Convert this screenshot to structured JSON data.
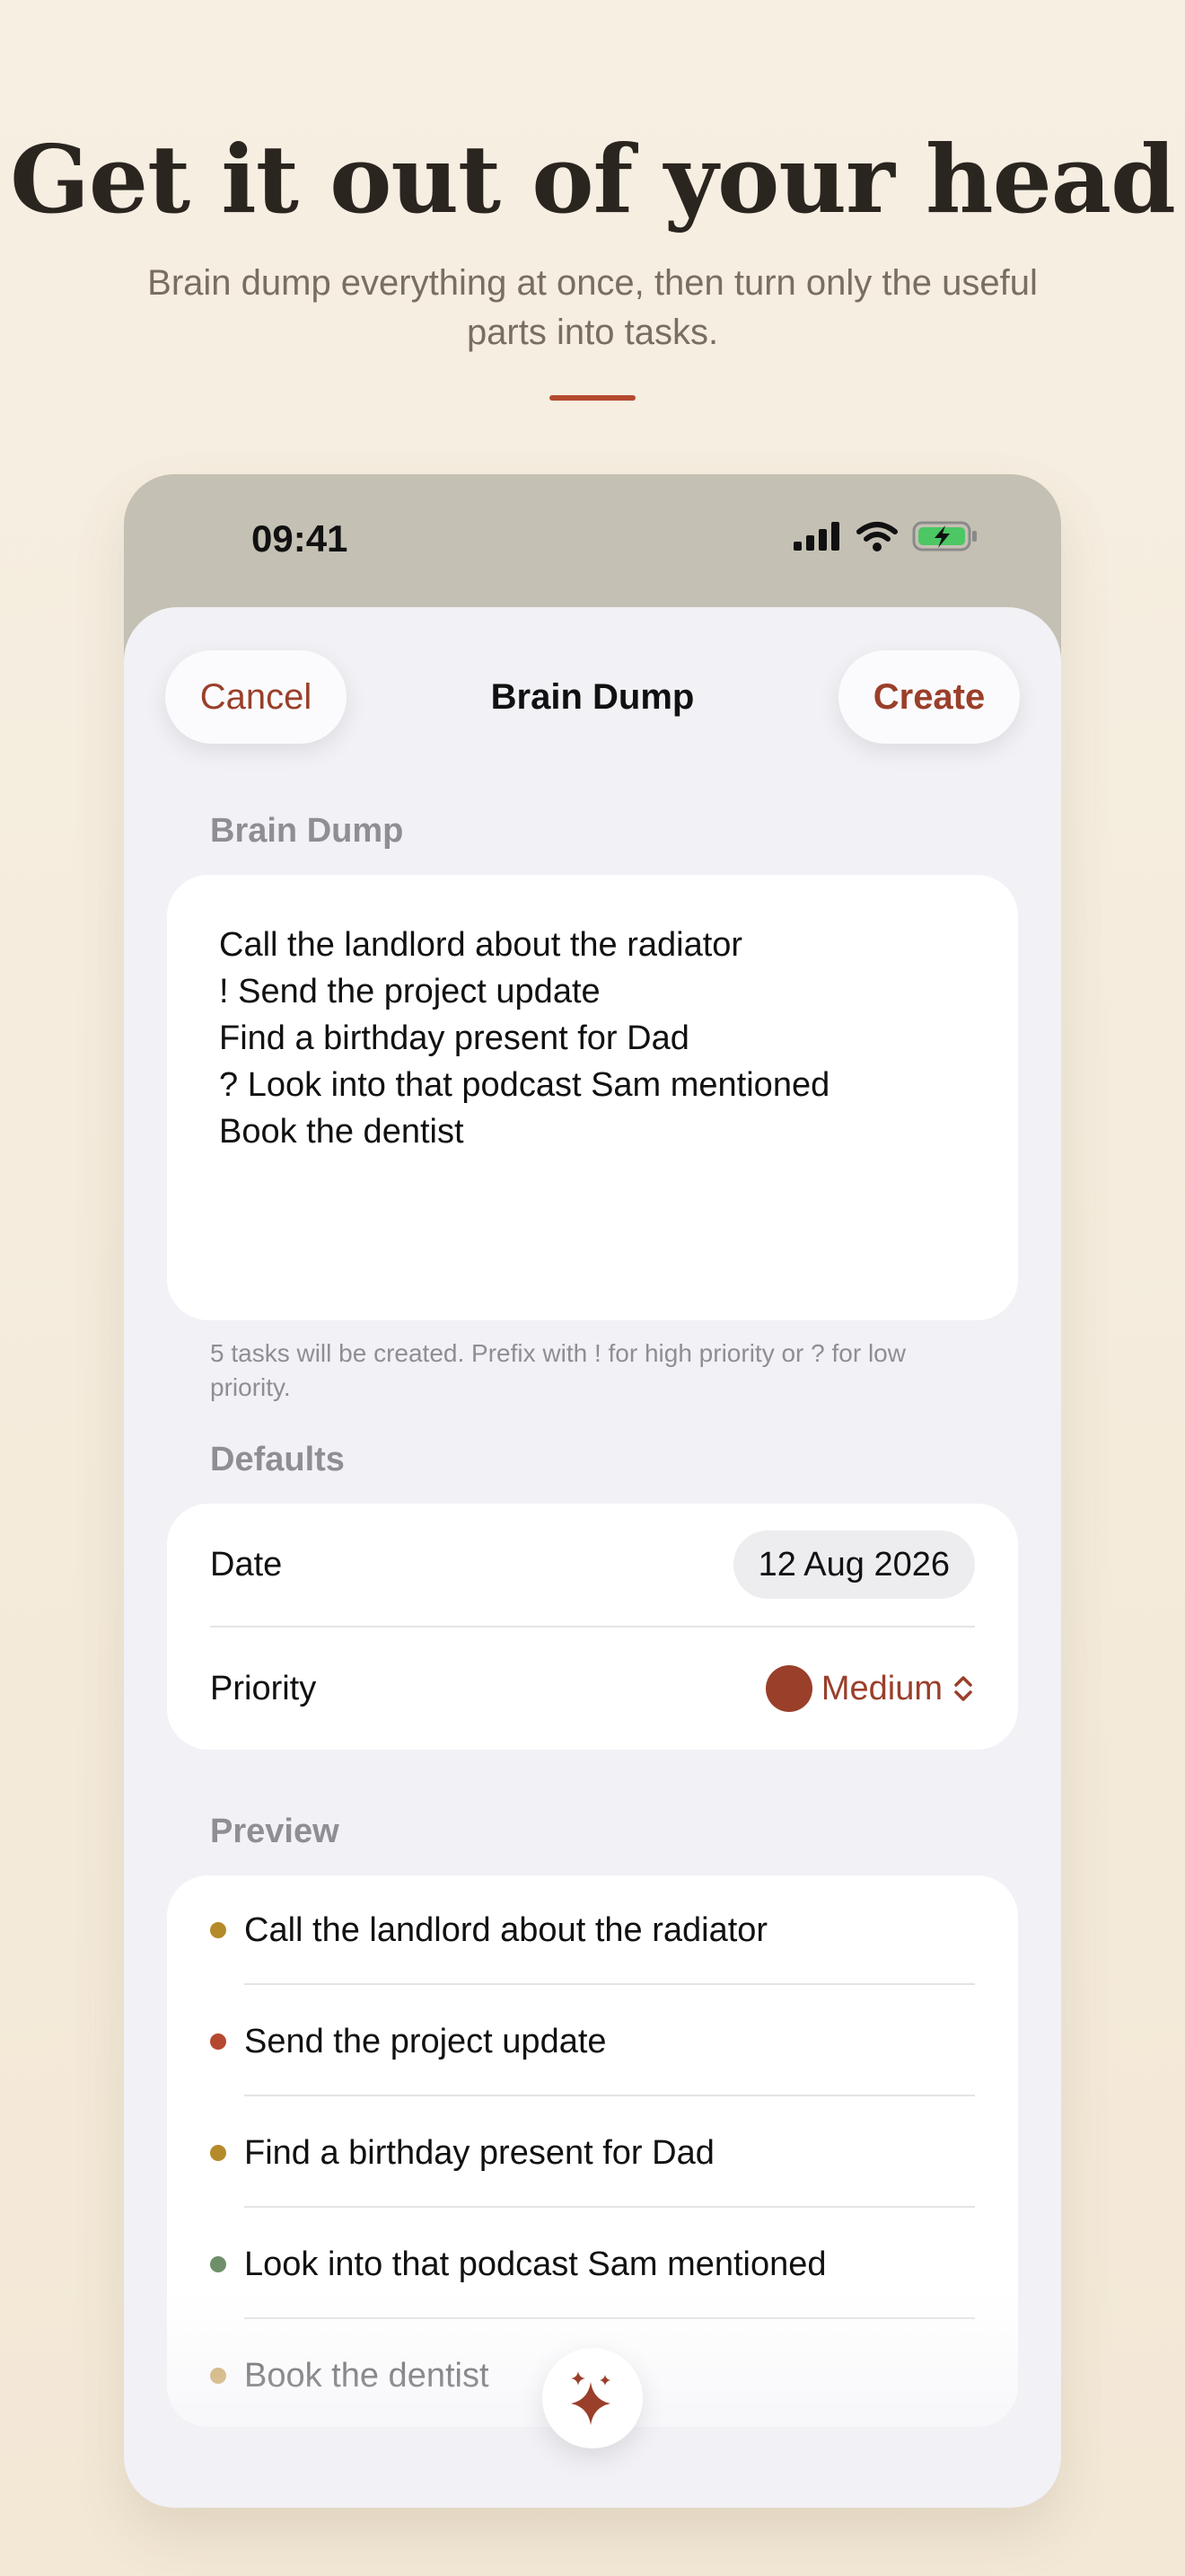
{
  "hero": {
    "title": "Get it out of your head",
    "subtitle": "Brain dump everything at once, then turn only the useful parts into tasks."
  },
  "status_bar": {
    "time": "09:41",
    "icons": [
      "cellular-signal-icon",
      "wifi-icon",
      "battery-charging-icon"
    ],
    "battery_color": "#4cc764"
  },
  "nav": {
    "cancel_label": "Cancel",
    "title": "Brain Dump",
    "create_label": "Create"
  },
  "brain_dump": {
    "section_label": "Brain Dump",
    "text": "Call the landlord about the radiator\n! Send the project update\nFind a birthday present for Dad\n? Look into that podcast Sam mentioned\nBook the dentist",
    "hint": "5 tasks will be created. Prefix with ! for high priority or ? for low priority."
  },
  "defaults": {
    "section_label": "Defaults",
    "date_label": "Date",
    "date_value": "12 Aug 2026",
    "priority_label": "Priority",
    "priority_value": "Medium",
    "priority_color": "#9a3f2a"
  },
  "preview": {
    "section_label": "Preview",
    "items": [
      {
        "label": "Call the landlord about the radiator",
        "color": "#b58a2a"
      },
      {
        "label": "Send the project update",
        "color": "#b5492f"
      },
      {
        "label": "Find a birthday present for Dad",
        "color": "#b58a2a"
      },
      {
        "label": "Look into that podcast Sam mentioned",
        "color": "#6f8f6a"
      },
      {
        "label": "Book the dentist",
        "color": "#c9a45c"
      }
    ]
  },
  "fab": {
    "icon": "sparkles-icon"
  },
  "colors": {
    "accent": "#9a3f2a",
    "background": "#f5ecdc",
    "sheet": "#f1f1f6"
  }
}
